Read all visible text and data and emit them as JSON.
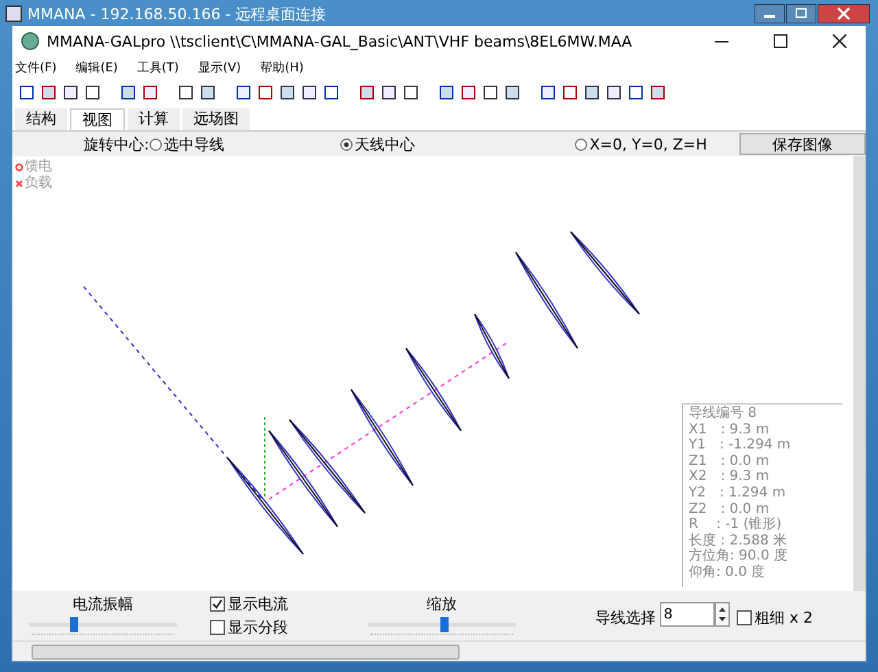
{
  "remote_title": "MMANA - 192.168.50.166 - 远程桌面连接",
  "window": {
    "title": "MMANA-GALpro \\\\tsclient\\C\\MMANA-GAL_Basic\\ANT\\VHF beams\\8EL6MW.MAA"
  },
  "menu": [
    "文件(F)",
    "编辑(E)",
    "工具(T)",
    "显示(V)",
    "帮助(H)"
  ],
  "tabs": [
    {
      "label": "结构",
      "selected": false
    },
    {
      "label": "视图",
      "selected": true
    },
    {
      "label": "计算",
      "selected": false
    },
    {
      "label": "远场图",
      "selected": false
    }
  ],
  "rotation": {
    "label": "旋转中心:",
    "options": [
      {
        "label": "选中导线",
        "selected": false
      },
      {
        "label": "天线中心",
        "selected": true
      },
      {
        "label": "X=0, Y=0, Z=H",
        "selected": false
      }
    ]
  },
  "save_button": "保存图像",
  "legend": [
    {
      "kind": "circle",
      "label": "馈电",
      "color": "#ff4040"
    },
    {
      "kind": "cross",
      "label": "负载",
      "color": "#ff4040"
    }
  ],
  "info": [
    "导线编号 8",
    "X1　:  9.3 m",
    "Y1　:  -1.294 m",
    "Z1　:  0.0 m",
    "X2　:  9.3 m",
    "Y2　:  1.294 m",
    "Z2　:  0.0 m",
    "R　 :  -1 (锥形)",
    "长度  : 2.588 米",
    "方位角:  90.0 度",
    "仰角:  0.0 度"
  ],
  "sliders": [
    {
      "label": "电流振幅",
      "level": 0.31
    },
    {
      "label": "缩放",
      "level": 0.52
    }
  ],
  "checkboxes": [
    {
      "label": "显示电流",
      "checked": true
    },
    {
      "label": "显示分段",
      "checked": false
    }
  ],
  "wire_select": {
    "label": "导线选择",
    "value": "8"
  },
  "thick": {
    "label": "粗细 x 2",
    "checked": false
  }
}
